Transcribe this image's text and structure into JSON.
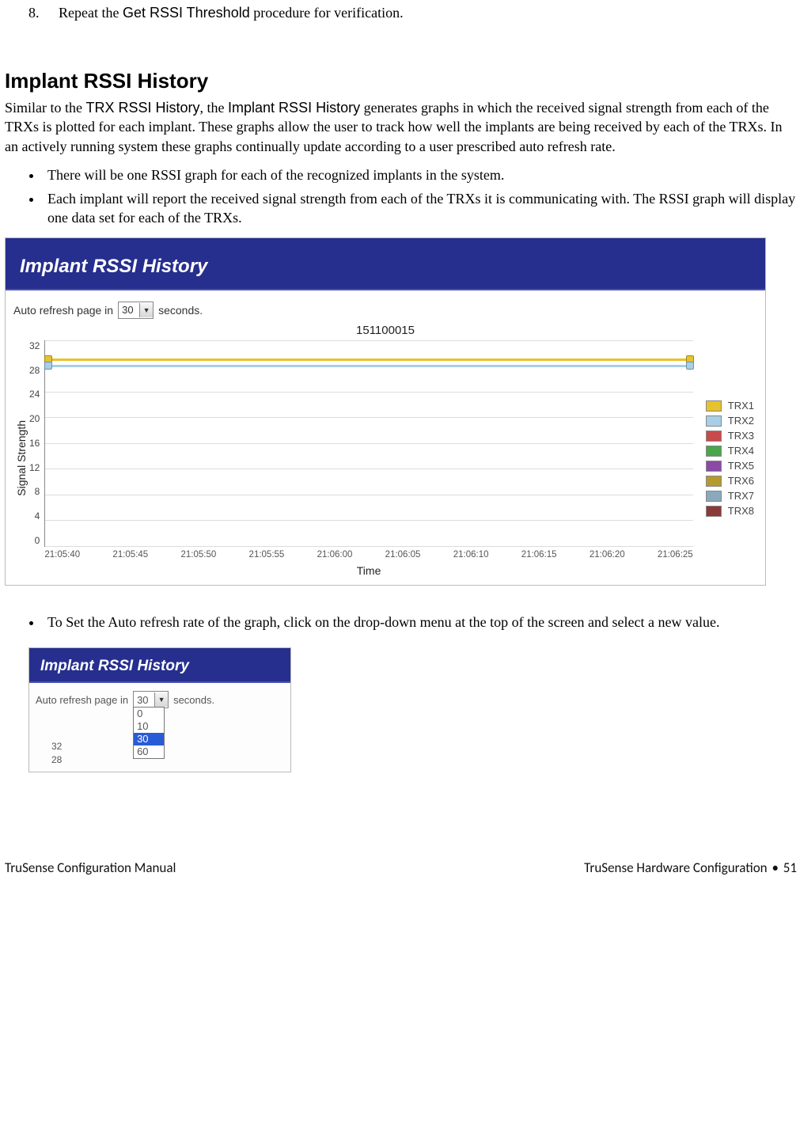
{
  "step8": {
    "num": "8.",
    "prefix": "Repeat the ",
    "proc": "Get RSSI Threshold",
    "suffix": " procedure for verification."
  },
  "section_heading": "Implant RSSI History",
  "intro": {
    "p1a": "Similar to the ",
    "p1b": "TRX RSSI History",
    "p1c": ", the ",
    "p1d": "Implant RSSI History",
    "p1e": " generates graphs in which the received signal strength from each of the TRXs is plotted for each implant. These graphs allow the user to track how well the implants are being received by each of the TRXs.  In an actively running system these graphs continually update according to a user prescribed auto refresh rate."
  },
  "bullets1": [
    "There will be one RSSI graph for each of the recognized implants in the system.",
    "Each implant will report the received signal strength from each of the TRXs it is communicating with. The RSSI graph will display one data set for each of the TRXs."
  ],
  "widget1": {
    "title": "Implant RSSI History",
    "refresh_prefix": "Auto refresh page in",
    "refresh_value": "30",
    "refresh_suffix": "seconds."
  },
  "chart_data": {
    "type": "line",
    "title": "151100015",
    "ylabel": "Signal Strength",
    "xlabel": "Time",
    "ylim": [
      0,
      32
    ],
    "yticks": [
      0,
      4,
      8,
      12,
      16,
      20,
      24,
      28,
      32
    ],
    "categories": [
      "21:05:40",
      "21:05:45",
      "21:05:50",
      "21:05:55",
      "21:06:00",
      "21:06:05",
      "21:06:10",
      "21:06:15",
      "21:06:20",
      "21:06:25"
    ],
    "series": [
      {
        "name": "TRX1",
        "color": "#e6c22e",
        "values": [
          29,
          29,
          29,
          29,
          29,
          29,
          29,
          29,
          29,
          29
        ]
      },
      {
        "name": "TRX2",
        "color": "#a8cfe8",
        "values": [
          28,
          28,
          28,
          28,
          28,
          28,
          28,
          28,
          28,
          28
        ]
      },
      {
        "name": "TRX3",
        "color": "#c94a4a",
        "values": null
      },
      {
        "name": "TRX4",
        "color": "#4aa64a",
        "values": null
      },
      {
        "name": "TRX5",
        "color": "#8b4aa6",
        "values": null
      },
      {
        "name": "TRX6",
        "color": "#b59a2e",
        "values": null
      },
      {
        "name": "TRX7",
        "color": "#8aa9bc",
        "values": null
      },
      {
        "name": "TRX8",
        "color": "#8b3a3a",
        "values": null
      }
    ]
  },
  "bullets2": [
    "To Set the Auto refresh rate of the graph, click on the drop-down menu at the top of the screen and select a new value."
  ],
  "widget2": {
    "title": "Implant RSSI History",
    "refresh_prefix": "Auto refresh page in",
    "refresh_value": "30",
    "refresh_suffix": "seconds.",
    "options": [
      "0",
      "10",
      "30",
      "60"
    ],
    "selected": "30",
    "mini_y": [
      "32",
      "28"
    ]
  },
  "footer": {
    "left": "TruSense Configuration Manual",
    "right_text": "TruSense Hardware Configuration",
    "page": "51"
  }
}
